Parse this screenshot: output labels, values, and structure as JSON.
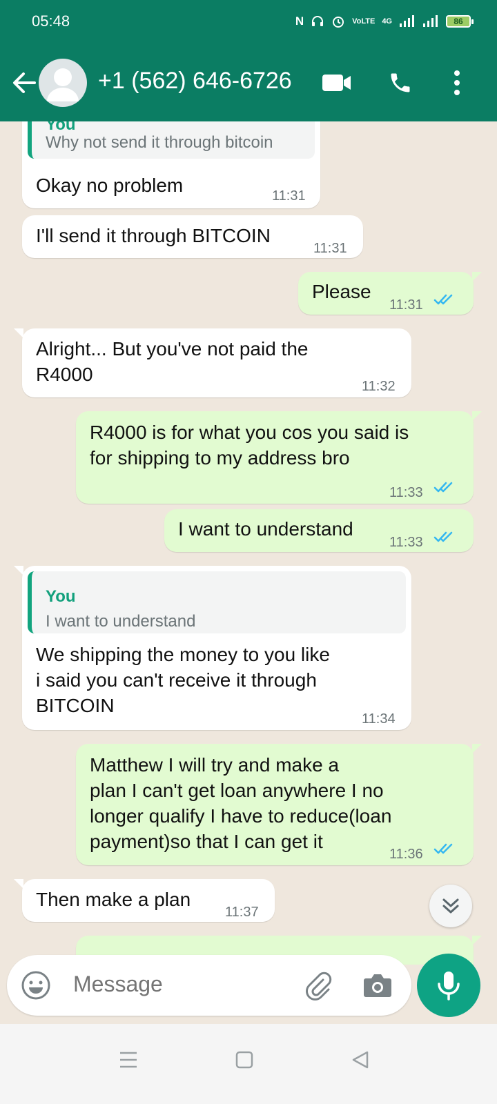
{
  "status_bar": {
    "time": "05:48",
    "network_type": "4G",
    "volte_label": "VoLTE",
    "battery": "86"
  },
  "header": {
    "contact_name": "+1 (562) 646-6726",
    "icons": [
      "back-arrow-icon",
      "avatar",
      "video-call-icon",
      "phone-icon",
      "more-vert-icon"
    ]
  },
  "messages": [
    {
      "dir": "in",
      "quote_author": "You",
      "quote_text": "Why not send it through bitcoin",
      "text": "Okay no problem",
      "time": "11:31"
    },
    {
      "dir": "in",
      "text": "I'll send it through BITCOIN",
      "time": "11:31"
    },
    {
      "dir": "out",
      "text": "Please",
      "time": "11:31",
      "read": true
    },
    {
      "dir": "in",
      "lines": [
        "Alright...  But you've not paid the",
        "R4000"
      ],
      "time": "11:32"
    },
    {
      "dir": "out",
      "lines": [
        "R4000 is for what you cos you said is",
        "for shipping to my address bro"
      ],
      "time": "11:33",
      "read": true
    },
    {
      "dir": "out",
      "text": "I want to understand",
      "time": "11:33",
      "read": true
    },
    {
      "dir": "in",
      "quote_author": "You",
      "quote_text": "I want to understand",
      "lines": [
        "We shipping the money to you like",
        "i said you can't receive it through",
        "BITCOIN"
      ],
      "time": "11:34"
    },
    {
      "dir": "out",
      "lines": [
        "Matthew I will try and make a",
        "plan I can't get loan anywhere I no",
        "longer qualify I have to reduce(loan",
        "payment)so that  I can get it"
      ],
      "time": "11:36",
      "read": true
    },
    {
      "dir": "in",
      "text": "Then make a plan",
      "time": "11:37"
    }
  ],
  "composer": {
    "placeholder": "Message",
    "icons": [
      "emoji-icon",
      "attach-icon",
      "camera-icon",
      "mic-icon"
    ]
  },
  "colors": {
    "header": "#0b7d63",
    "outgoing_bubble": "#e2fbd1",
    "incoming_bubble": "#ffffff",
    "read_ticks": "#34b7f1",
    "accent": "#0ea384",
    "background": "#efe7dd"
  }
}
